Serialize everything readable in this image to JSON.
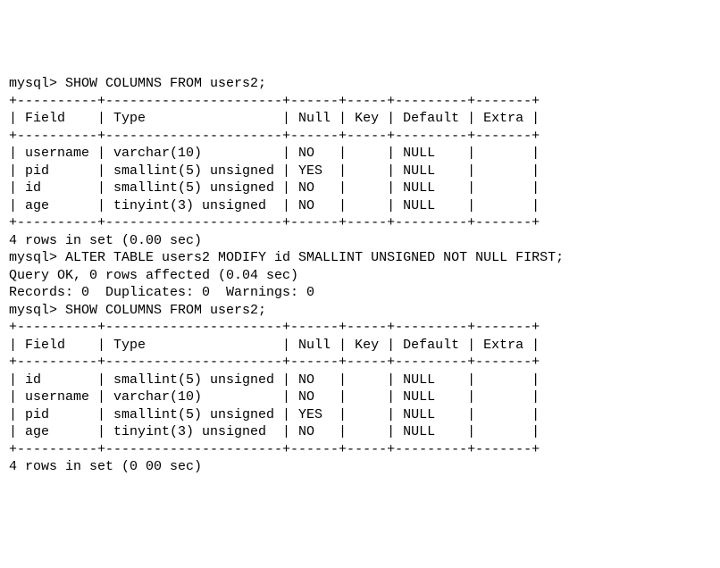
{
  "prompt": "mysql>",
  "cmd1": "SHOW COLUMNS FROM users2;",
  "cmd2": "ALTER TABLE users2 MODIFY id SMALLINT UNSIGNED NOT NULL FIRST;",
  "cmd3": "SHOW COLUMNS FROM users2;",
  "alter_result_line1": "Query OK, 0 rows affected (0.04 sec)",
  "alter_result_line2": "Records: 0  Duplicates: 0  Warnings: 0",
  "rows_summary": "4 rows in set (0.00 sec)",
  "rows_summary_cut": "4 rows in set (0 00 sec)",
  "chart_data": [
    {
      "type": "table",
      "title": "SHOW COLUMNS FROM users2 (before ALTER)",
      "columns": [
        "Field",
        "Type",
        "Null",
        "Key",
        "Default",
        "Extra"
      ],
      "rows": [
        {
          "Field": "username",
          "Type": "varchar(10)",
          "Null": "NO",
          "Key": "",
          "Default": "NULL",
          "Extra": ""
        },
        {
          "Field": "pid",
          "Type": "smallint(5) unsigned",
          "Null": "YES",
          "Key": "",
          "Default": "NULL",
          "Extra": ""
        },
        {
          "Field": "id",
          "Type": "smallint(5) unsigned",
          "Null": "NO",
          "Key": "",
          "Default": "NULL",
          "Extra": ""
        },
        {
          "Field": "age",
          "Type": "tinyint(3) unsigned",
          "Null": "NO",
          "Key": "",
          "Default": "NULL",
          "Extra": ""
        }
      ]
    },
    {
      "type": "table",
      "title": "SHOW COLUMNS FROM users2 (after ALTER)",
      "columns": [
        "Field",
        "Type",
        "Null",
        "Key",
        "Default",
        "Extra"
      ],
      "rows": [
        {
          "Field": "id",
          "Type": "smallint(5) unsigned",
          "Null": "NO",
          "Key": "",
          "Default": "NULL",
          "Extra": ""
        },
        {
          "Field": "username",
          "Type": "varchar(10)",
          "Null": "NO",
          "Key": "",
          "Default": "NULL",
          "Extra": ""
        },
        {
          "Field": "pid",
          "Type": "smallint(5) unsigned",
          "Null": "YES",
          "Key": "",
          "Default": "NULL",
          "Extra": ""
        },
        {
          "Field": "age",
          "Type": "tinyint(3) unsigned",
          "Null": "NO",
          "Key": "",
          "Default": "NULL",
          "Extra": ""
        }
      ]
    }
  ],
  "widths": {
    "Field": 10,
    "Type": 22,
    "Null": 6,
    "Key": 5,
    "Default": 9,
    "Extra": 7
  }
}
